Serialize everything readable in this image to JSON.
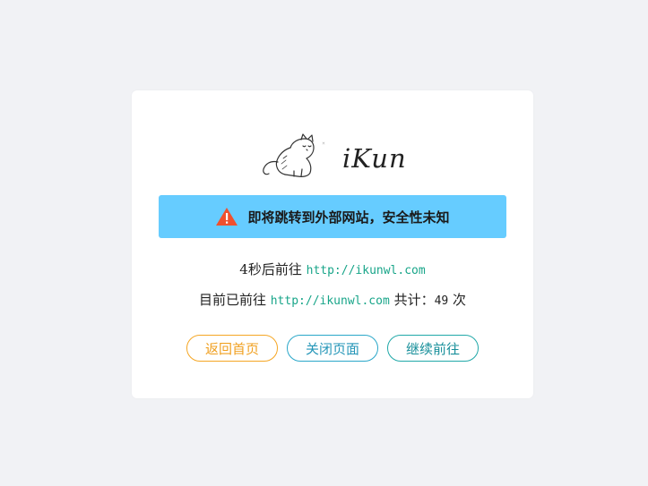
{
  "brand": {
    "logo_text": "iKun"
  },
  "warning": {
    "icon": "warning-triangle-icon",
    "text": "即将跳转到外部网站，安全性未知"
  },
  "redirect": {
    "countdown_prefix": "4秒后前往",
    "url": "http://ikunwl.com"
  },
  "history": {
    "prefix": "目前已前往",
    "url": "http://ikunwl.com",
    "count_label": "共计：",
    "count": "49",
    "count_unit": "次"
  },
  "buttons": {
    "home": "返回首页",
    "close": "关闭页面",
    "continue": "继续前往"
  },
  "colors": {
    "page_bg": "#f1f2f5",
    "banner_bg": "#66ccff",
    "warning_icon": "#f0502e",
    "link": "#18a589",
    "home_btn": "#f5a623",
    "close_btn": "#2aa7c9",
    "continue_btn": "#20a8a8"
  }
}
